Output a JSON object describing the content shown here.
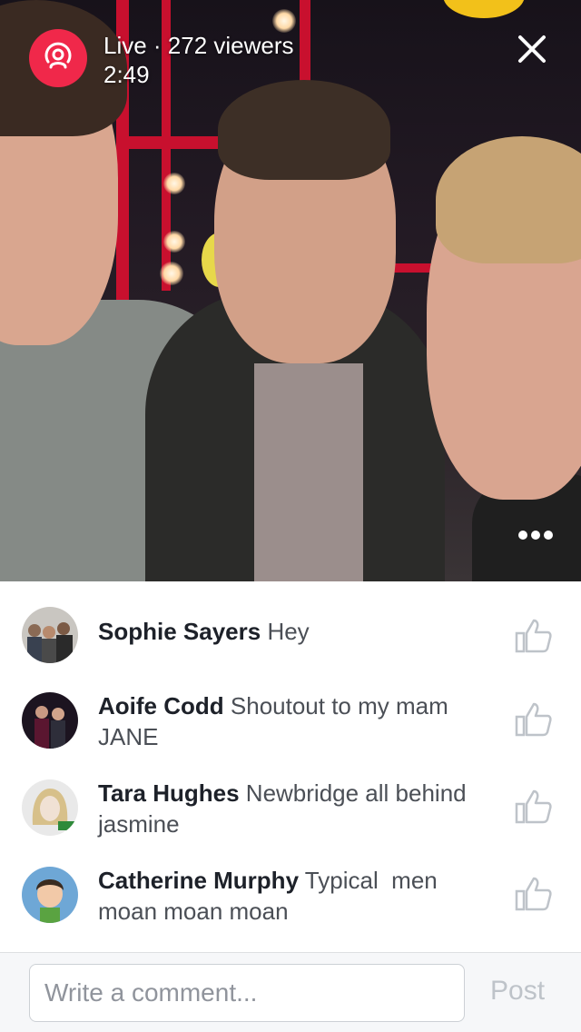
{
  "live": {
    "status": "Live · 272 viewers",
    "timer": "2:49",
    "icon": "live-broadcast-icon",
    "badge_color": "#f0284a"
  },
  "video": {
    "close_icon": "close-icon",
    "more_icon": "more-options-icon"
  },
  "comments": [
    {
      "author": "Sophie Sayers",
      "text": "Hey",
      "avatar": "avatar-photo-group",
      "like_icon": "thumbs-up-icon"
    },
    {
      "author": "Aoife Codd",
      "text": "Shoutout to my mam JANE",
      "avatar": "avatar-photo-friends",
      "like_icon": "thumbs-up-icon"
    },
    {
      "author": "Tara Hughes",
      "text": "Newbridge all behind jasmine",
      "avatar": "avatar-photo-portrait",
      "like_icon": "thumbs-up-icon"
    },
    {
      "author": "Catherine Murphy",
      "text": "Typical  men moan moan moan",
      "avatar": "avatar-photo-cartoon",
      "like_icon": "thumbs-up-icon"
    }
  ],
  "composer": {
    "placeholder": "Write a comment...",
    "post_label": "Post",
    "post_color": "#bec3c9"
  }
}
